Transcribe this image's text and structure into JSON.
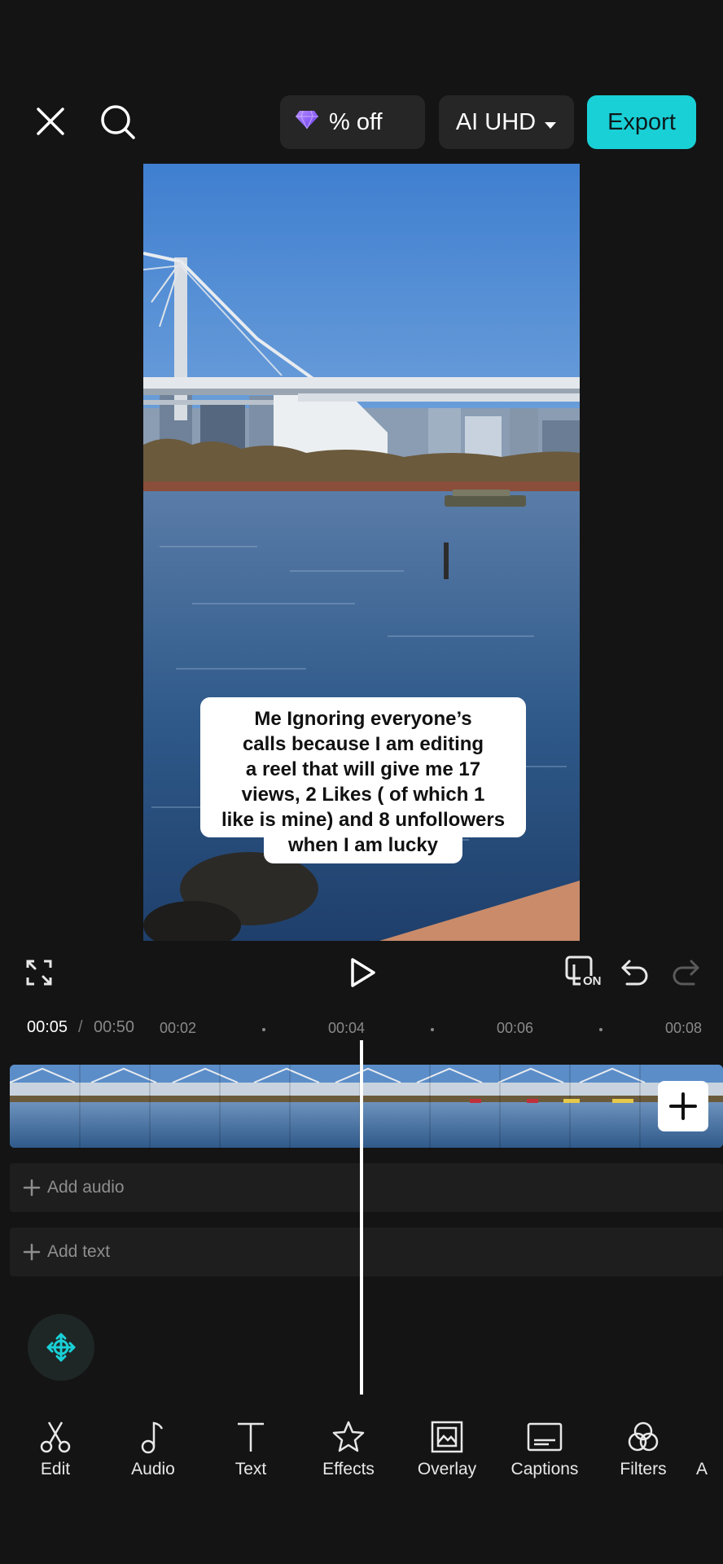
{
  "header": {
    "close_icon": "close-icon",
    "search_icon": "search-icon",
    "promo_label": "% off",
    "promo_icon": "diamond-icon",
    "quality_label": "AI UHD",
    "export_label": "Export",
    "accent_color": "#19d0d6"
  },
  "preview": {
    "caption_lines": [
      "Me Ignoring everyone’s",
      "calls because I am editing",
      "a reel that will give me 17",
      "views, 2 Likes ( of which 1",
      "like is mine) and 8 unfollowers",
      "when I am lucky"
    ]
  },
  "controls": {
    "fullscreen_icon": "fullscreen-icon",
    "play_icon": "play-icon",
    "preview_toggle_label": "ON",
    "undo_icon": "undo-icon",
    "redo_icon": "redo-icon"
  },
  "timeline": {
    "current_time": "00:05",
    "separator": "/",
    "duration": "00:50",
    "ticks": [
      "00:02",
      "00:04",
      "00:06",
      "00:08"
    ],
    "add_audio_label": "Add audio",
    "add_text_label": "Add text"
  },
  "toolbar": {
    "items": [
      {
        "label": "Edit",
        "icon": "scissors-icon"
      },
      {
        "label": "Audio",
        "icon": "music-note-icon"
      },
      {
        "label": "Text",
        "icon": "text-icon"
      },
      {
        "label": "Effects",
        "icon": "star-icon"
      },
      {
        "label": "Overlay",
        "icon": "overlay-icon"
      },
      {
        "label": "Captions",
        "icon": "captions-icon"
      },
      {
        "label": "Filters",
        "icon": "filters-icon"
      },
      {
        "label": "A",
        "icon": "partial-icon"
      }
    ]
  }
}
